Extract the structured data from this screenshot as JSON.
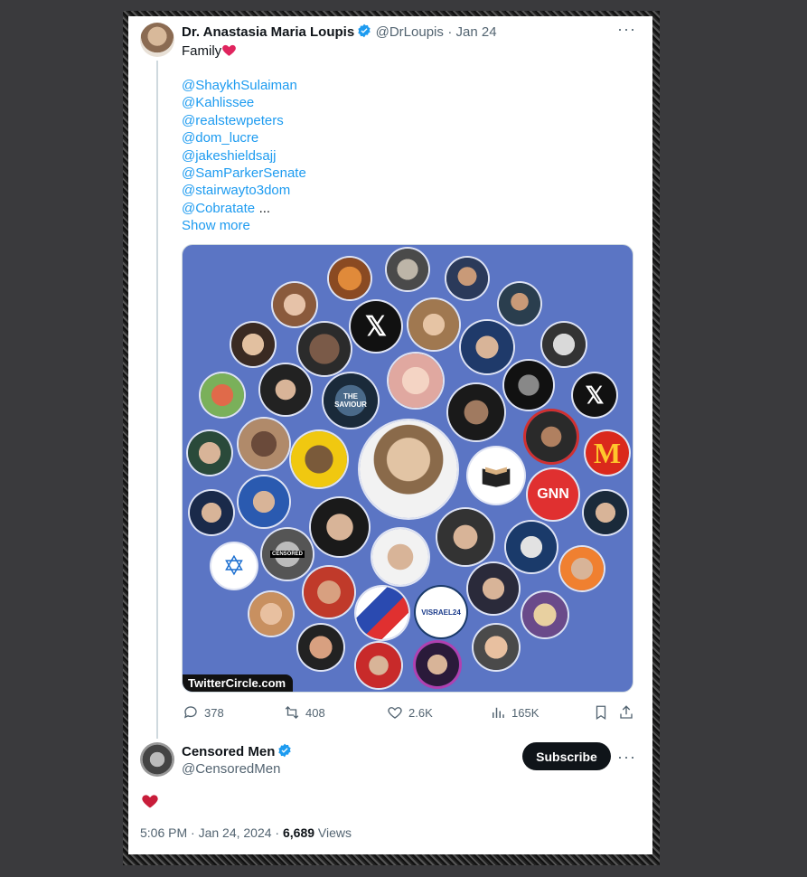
{
  "tweet": {
    "author_name": "Dr. Anastasia Maria Loupis",
    "author_handle": "@DrLoupis",
    "date": "· Jan 24",
    "text": "Family",
    "mentions": [
      "@ShaykhSulaiman",
      "@Kahlissee",
      "@realstewpeters",
      "@dom_lucre",
      "@jakeshieldsajj",
      "@SamParkerSenate",
      "@stairwayto3dom",
      "@Cobratate"
    ],
    "ellipsis": "...",
    "show_more": "Show more",
    "image_watermark": "TwitterCircle.com",
    "image_labels": {
      "saviour": "THE SAVIOUR",
      "gnn": "GNN",
      "censored": "CENSORED",
      "visrael": "VISRAEL24"
    },
    "stats": {
      "replies": "378",
      "reposts": "408",
      "likes": "2.6K",
      "views": "165K"
    }
  },
  "reply": {
    "author_name": "Censored Men",
    "author_handle": "@CensoredMen",
    "subscribe_label": "Subscribe",
    "time": "5:06 PM · Jan 24, 2024 · ",
    "views_count": "6,689",
    "views_label": " Views"
  },
  "colors": {
    "accent": "#1d9bf0",
    "image_bg": "#5b75c4",
    "heart": "#c81d3a"
  },
  "icons": [
    "verified-icon",
    "more-icon",
    "reply-icon",
    "repost-icon",
    "like-icon",
    "views-icon",
    "bookmark-icon",
    "share-icon",
    "heart-icon"
  ]
}
